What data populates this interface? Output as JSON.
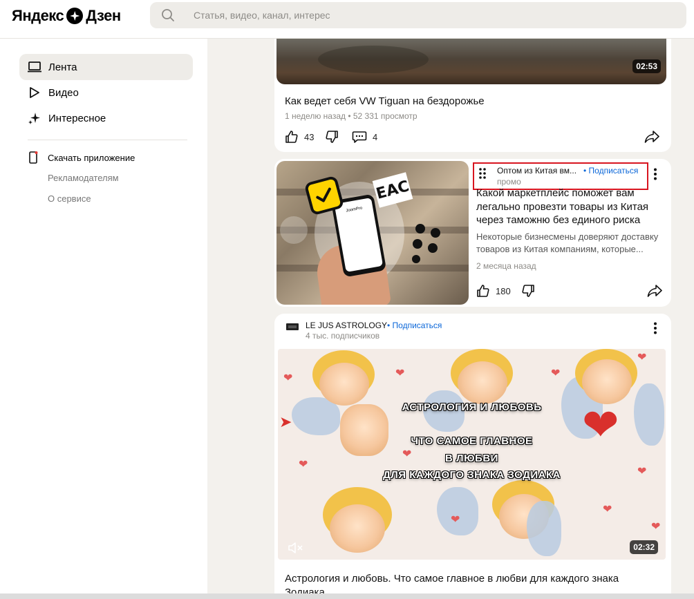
{
  "header": {
    "logo_left": "Яндекс",
    "logo_right": "Дзен",
    "search_placeholder": "Статья, видео, канал, интерес"
  },
  "sidebar": {
    "items": [
      {
        "label": "Лента",
        "icon": "laptop-icon",
        "active": true
      },
      {
        "label": "Видео",
        "icon": "play-icon",
        "active": false
      },
      {
        "label": "Интересное",
        "icon": "sparkle-icon",
        "active": false
      }
    ],
    "app_link": "Скачать приложение",
    "links": [
      "Рекламодателям",
      "О сервисе"
    ]
  },
  "feed": {
    "video_card": {
      "duration": "02:53",
      "title": "Как ведет себя VW Tiguan на бездорожье",
      "meta": "1 неделю назад • 52 331 просмотр",
      "likes": "43",
      "comments": "4"
    },
    "promo_card": {
      "source": "Оптом из Китая вм...",
      "subscribe": "• Подписаться",
      "label": "промо",
      "title": "Какой маркетплейс поможет вам легально провезти товары из Китая через таможню без единого риска",
      "snippet": "Некоторые бизнесмены доверяют доставку товаров из Китая компаниям, которые...",
      "date": "2 месяца назад",
      "likes": "180",
      "image_badge_text": "EAC",
      "phone_brand": "JoomPro"
    },
    "astro_card": {
      "source": "LE JUS ASTROLOGY",
      "subscribe": "• Подписаться",
      "subscribers": "4 тыс. подписчиков",
      "overlay_line1": "АСТРОЛОГИЯ И ЛЮБОВЬ",
      "overlay_line2": "ЧТО САМОЕ ГЛАВНОЕ",
      "overlay_line3": "В ЛЮБВИ",
      "overlay_line4": "ДЛЯ КАЖДОГО ЗНАКА ЗОДИАКА",
      "duration": "02:32",
      "title": "Астрология и любовь. Что самое главное в любви для каждого знака Зодиака."
    }
  },
  "colors": {
    "accent_link": "#0a66d8",
    "highlight_box": "#d8141f",
    "page_bg": "#f3f1ed"
  }
}
